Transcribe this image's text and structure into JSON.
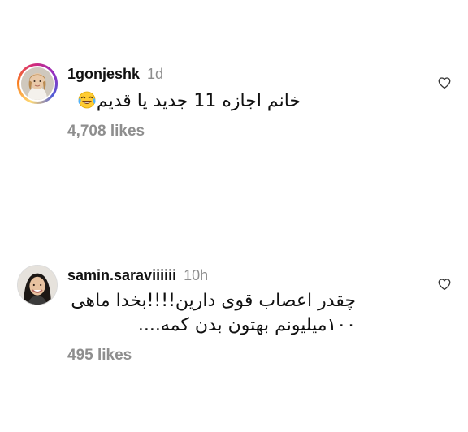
{
  "comments": [
    {
      "username": "1gonjeshk",
      "timestamp": "1d",
      "text_lines": [
        "خانم اجازه 11 جدید یا قدیم"
      ],
      "emoji": "face-with-tears-of-joy",
      "likes": "4,708 likes",
      "has_story_ring": true,
      "like_icon": "heart-outline-icon"
    },
    {
      "username": "samin.saraviiiiii",
      "timestamp": "10h",
      "text_lines": [
        "چقدر اعصاب قوی دارین!!!!بخدا ماهی",
        "۱۰۰میلیونم بهتون بدن کمه...."
      ],
      "likes": "495 likes",
      "has_story_ring": false,
      "like_icon": "heart-outline-icon"
    }
  ],
  "colors": {
    "text": "#111111",
    "muted": "#8e8e8e",
    "background": "#ffffff"
  }
}
